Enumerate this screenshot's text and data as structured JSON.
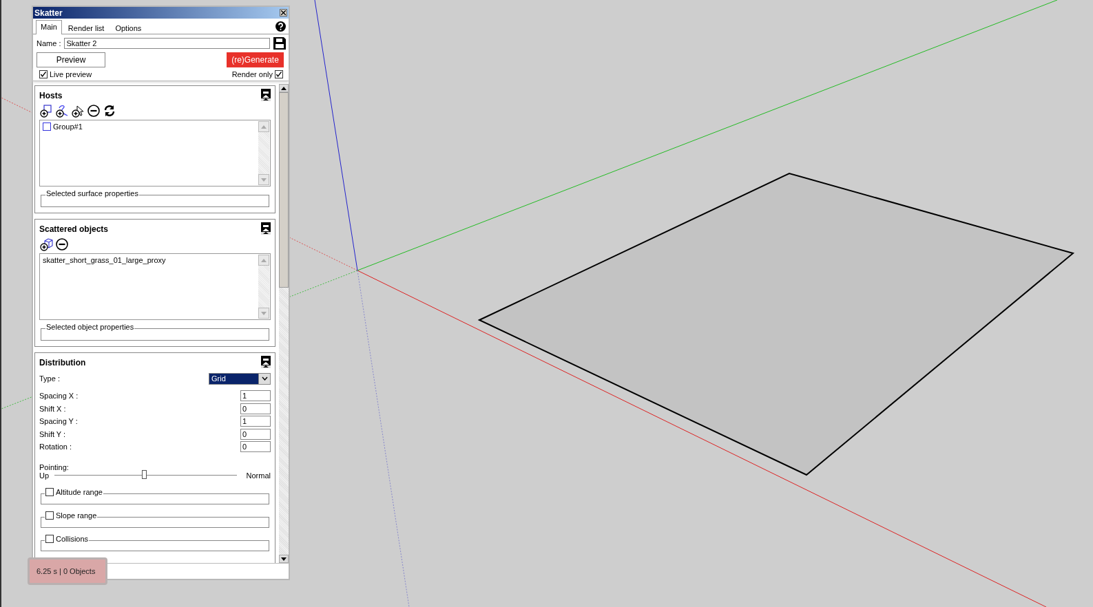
{
  "window": {
    "title": "Skatter"
  },
  "tabs": [
    {
      "label": "Main",
      "selected": true
    },
    {
      "label": "Render list",
      "selected": false
    },
    {
      "label": "Options",
      "selected": false
    }
  ],
  "name_field": {
    "label": "Name :",
    "value": "Skatter 2"
  },
  "buttons": {
    "preview": "Preview",
    "generate": "(re)Generate"
  },
  "live_preview": {
    "label": "Live preview",
    "checked": true
  },
  "render_only": {
    "label": "Render only",
    "checked": true
  },
  "hosts": {
    "title": "Hosts",
    "items": [
      {
        "label": "Group#1",
        "checked": false
      }
    ],
    "properties_label": "Selected surface properties"
  },
  "scattered_objects": {
    "title": "Scattered objects",
    "items": [
      {
        "label": "skatter_short_grass_01_large_proxy"
      }
    ],
    "properties_label": "Selected object properties"
  },
  "distribution": {
    "title": "Distribution",
    "type": {
      "label": "Type :",
      "value": "Grid"
    },
    "fields": [
      {
        "label": "Spacing X :",
        "value": "1"
      },
      {
        "label": "Shift X :",
        "value": "0"
      },
      {
        "label": "Spacing Y :",
        "value": "1"
      },
      {
        "label": "Shift Y :",
        "value": "0"
      },
      {
        "label": "Rotation :",
        "value": "0"
      }
    ],
    "pointing": {
      "label": "Pointing:",
      "min_label": "Up",
      "max_label": "Normal",
      "level": 0.49
    },
    "options": [
      {
        "label": "Altitude range",
        "checked": false
      },
      {
        "label": "Slope range",
        "checked": false
      },
      {
        "label": "Collisions",
        "checked": false
      }
    ]
  },
  "status_bar": "6.25 s | 0 Objects"
}
